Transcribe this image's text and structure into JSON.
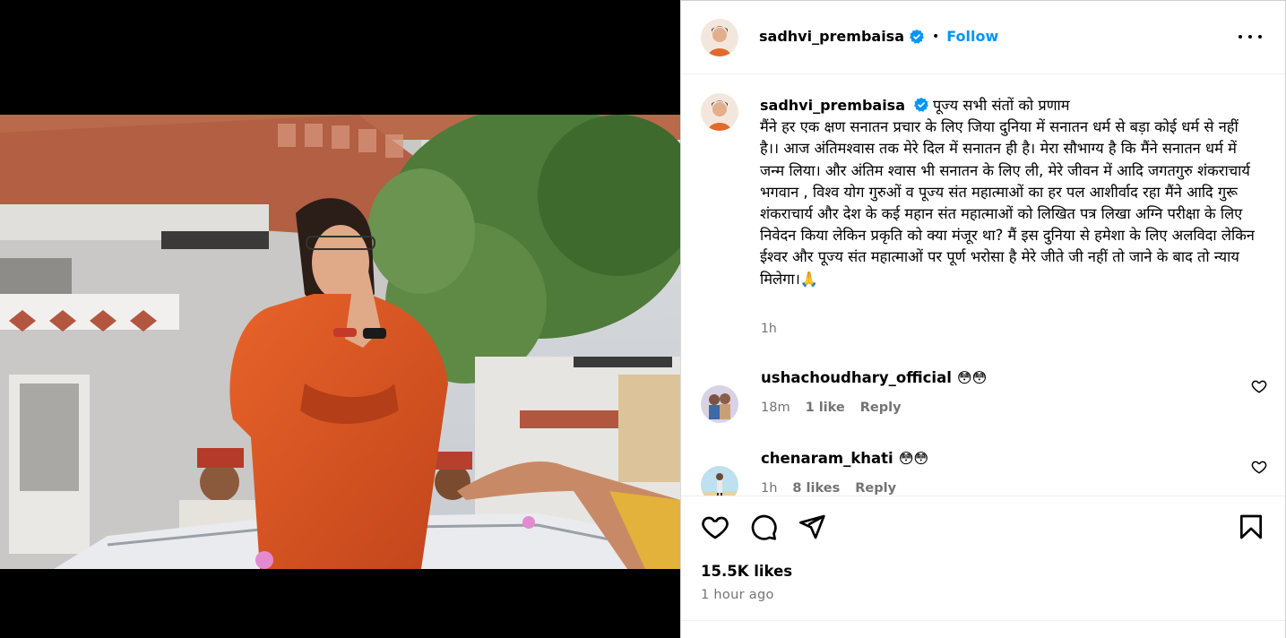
{
  "post": {
    "username": "sadhvi_prembaisa",
    "follow_label": "Follow",
    "separator": "•",
    "caption_lines": [
      "पूज्य सभी संतों को प्रणाम",
      "मैंने हर एक क्षण सनातन प्रचार के लिए जिया दुनिया में सनातन धर्म से बड़ा कोई धर्म से नहीं है।। आज अंतिमश्वास तक मेरे दिल में सनातन ही है। मेरा सौभाग्य है कि मैंने सनातन धर्म में जन्म लिया। और अंतिम श्वास भी सनातन के लिए ली, मेरे जीवन में आदि जगतगुरु शंकराचार्य भगवान , विश्व योग गुरुओं व पूज्य संत महात्माओं का हर पल आशीर्वाद रहा मैंने आदि गुरू शंकराचार्य और देश के कई महान संत महात्माओं को लिखित पत्र लिखा अग्नि परीक्षा के लिए निवेदन किया लेकिन प्रकृति को क्या मंजूर था? मैं इस दुनिया से हमेशा के लिए अलविदा लेकिन ईश्वर और पूज्य संत महात्माओं पर पूर्ण भरोसा है मेरे जीते जी नहीं तो जाने के बाद तो न्याय मिलेगा।🙏"
    ],
    "caption_time": "1h",
    "likes": "15.5K likes",
    "posted": "1 hour ago"
  },
  "comments": [
    {
      "username": "ushachoudhary_official",
      "text": "😳😳",
      "time": "18m",
      "likes": "1 like",
      "reply": "Reply"
    },
    {
      "username": "chenaram_khati",
      "text": "😳😳",
      "time": "1h",
      "likes": "8 likes",
      "reply": "Reply"
    }
  ],
  "colors": {
    "accent": "#0095f6",
    "verified": "#0095f6",
    "robe": "#d9541f",
    "muted": "#737373"
  },
  "icons": [
    "verified-badge-icon",
    "more-options-icon",
    "heart-icon",
    "comment-icon",
    "share-icon",
    "bookmark-icon"
  ]
}
